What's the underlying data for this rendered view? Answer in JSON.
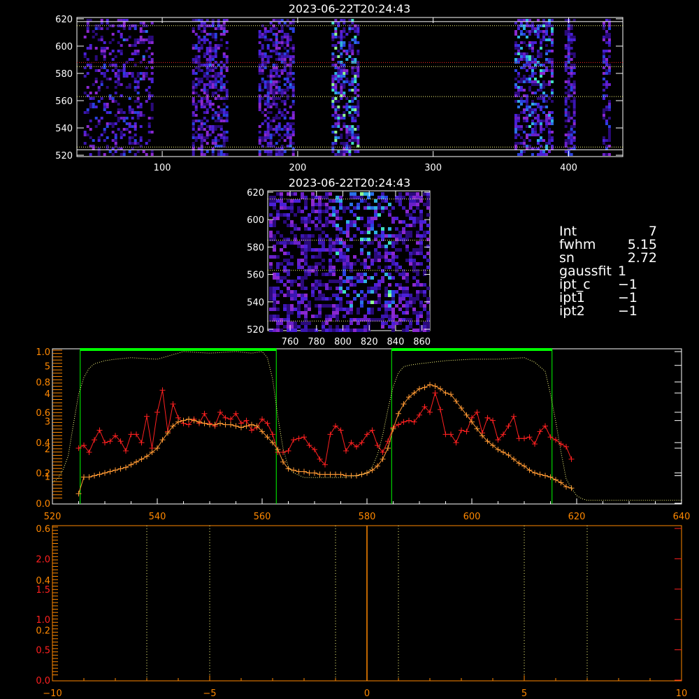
{
  "colors": {
    "white": "#ffffff",
    "red": "#ff2020",
    "orange": "#ff9933",
    "green": "#00ff00",
    "yellow": "#ffff80",
    "axis_orange": "#ff8800",
    "axis_red": "#ff2020"
  },
  "info": [
    {
      "k": "Int",
      "v": "7"
    },
    {
      "k": "fwhm",
      "v": "5.15"
    },
    {
      "k": "sn",
      "v": "2.72"
    },
    {
      "k": "gaussfit",
      "v": "1"
    },
    {
      "k": "ipt_c",
      "v": "−1"
    },
    {
      "k": "ipt1",
      "v": "−1"
    },
    {
      "k": "ipt2",
      "v": "−1"
    }
  ],
  "chart_data": [
    {
      "type": "heatmap",
      "title": "2023-06-22T20:24:43",
      "xlim": [
        37,
        440
      ],
      "ylim": [
        519,
        621
      ],
      "xticks": [
        "100",
        "200",
        "300",
        "400"
      ],
      "xtick_values": [
        100,
        200,
        300,
        400
      ],
      "yticks": [
        "520",
        "540",
        "560",
        "580",
        "600",
        "620"
      ],
      "ytick_values": [
        520,
        540,
        560,
        580,
        600,
        620
      ],
      "hlines": [
        {
          "y": 524,
          "color": "white"
        },
        {
          "y": 618,
          "color": "white"
        },
        {
          "y": 615,
          "color": "yellow",
          "style": "dotted"
        },
        {
          "y": 588,
          "color": "red",
          "style": "dotted"
        },
        {
          "y": 585,
          "color": "yellow",
          "style": "dotted"
        },
        {
          "y": 563,
          "color": "yellow",
          "style": "dotted"
        },
        {
          "y": 526,
          "color": "yellow",
          "style": "dotted"
        }
      ],
      "active_bands": [
        [
          42,
          92
        ],
        [
          122,
          147
        ],
        [
          171,
          197
        ],
        [
          225,
          245
        ],
        [
          360,
          387
        ],
        [
          397,
          405
        ],
        [
          425,
          430
        ]
      ]
    },
    {
      "type": "heatmap",
      "title": "2023-06-22T20:24:43",
      "xlim": [
        743,
        866
      ],
      "ylim": [
        519,
        621
      ],
      "xticks": [
        "760",
        "780",
        "800",
        "820",
        "840",
        "860"
      ],
      "xtick_values": [
        760,
        780,
        800,
        820,
        840,
        860
      ],
      "yticks": [
        "520",
        "540",
        "560",
        "580",
        "600",
        "620"
      ],
      "ytick_values": [
        520,
        540,
        560,
        580,
        600,
        620
      ],
      "hlines": [
        {
          "y": 615,
          "color": "yellow",
          "style": "dotted"
        },
        {
          "y": 585,
          "color": "yellow",
          "style": "dotted"
        },
        {
          "y": 563,
          "color": "yellow",
          "style": "dotted"
        },
        {
          "y": 526,
          "color": "yellow",
          "style": "dotted"
        }
      ]
    },
    {
      "type": "line",
      "xlim": [
        520,
        640
      ],
      "xticks": [
        "520",
        "540",
        "560",
        "580",
        "600",
        "620",
        "640"
      ],
      "xtick_values": [
        520,
        540,
        560,
        580,
        600,
        620,
        640
      ],
      "left_axis_labels": [
        {
          "text": "1.0",
          "value": 1.0
        },
        {
          "text": "0.8",
          "value": 0.8
        },
        {
          "text": "0.6",
          "value": 0.6
        },
        {
          "text": "0.4",
          "value": 0.4
        },
        {
          "text": "0.2",
          "value": 0.2
        },
        {
          "text": "0.0",
          "value": 0.0
        }
      ],
      "second_axis_labels": [
        {
          "text": "5",
          "value": 5
        },
        {
          "text": "4",
          "value": 4
        },
        {
          "text": "3",
          "value": 3
        },
        {
          "text": "2",
          "value": 2
        },
        {
          "text": "1",
          "value": 1
        }
      ],
      "vlines": [
        525.3,
        562.7,
        584.7,
        615.3
      ],
      "bars": [
        [
          525.3,
          562.7
        ],
        [
          584.7,
          615.3
        ]
      ],
      "series": [
        {
          "color": "red",
          "marker": "+",
          "unit": "second_axis",
          "x": [
            525,
            526,
            527,
            528,
            529,
            530,
            531,
            532,
            533,
            534,
            535,
            536,
            537,
            538,
            539,
            540,
            541,
            542,
            543,
            544,
            545,
            546,
            547,
            548,
            549,
            550,
            551,
            552,
            553,
            554,
            555,
            556,
            557,
            558,
            559,
            560,
            561,
            562,
            563,
            564,
            565,
            566,
            567,
            568,
            569,
            570,
            571,
            572,
            573,
            574,
            575,
            576,
            577,
            578,
            579,
            580,
            581,
            582,
            583,
            584,
            585,
            586,
            587,
            588,
            589,
            590,
            591,
            592,
            593,
            594,
            595,
            596,
            597,
            598,
            599,
            600,
            601,
            602,
            603,
            604,
            605,
            606,
            607,
            608,
            609,
            610,
            611,
            612,
            613,
            614,
            615,
            616,
            617,
            618,
            619
          ],
          "y": [
            2.0,
            2.1,
            1.85,
            2.3,
            2.65,
            2.2,
            2.25,
            2.45,
            2.25,
            1.9,
            2.5,
            2.5,
            2.2,
            3.15,
            2.0,
            3.3,
            4.1,
            2.6,
            3.6,
            3.1,
            2.9,
            2.85,
            3.05,
            2.9,
            3.25,
            2.9,
            2.8,
            3.3,
            3.1,
            3.05,
            3.25,
            2.9,
            3.0,
            2.65,
            2.75,
            3.05,
            2.9,
            2.5,
            1.85,
            1.85,
            1.9,
            2.3,
            2.35,
            2.4,
            2.1,
            1.95,
            1.6,
            1.4,
            2.5,
            2.8,
            2.65,
            1.9,
            2.2,
            2.05,
            2.2,
            2.5,
            2.65,
            2.1,
            1.85,
            2.25,
            2.75,
            2.85,
            2.95,
            3.0,
            2.95,
            3.2,
            3.5,
            3.3,
            4.0,
            3.4,
            2.5,
            2.5,
            2.2,
            2.65,
            2.6,
            3.1,
            3.3,
            2.55,
            3.1,
            3.0,
            2.3,
            2.5,
            2.8,
            3.15,
            2.35,
            2.35,
            2.4,
            2.15,
            2.6,
            2.8,
            2.4,
            2.3,
            2.15,
            2.05,
            1.6
          ]
        },
        {
          "color": "orange",
          "marker": "+",
          "unit": "second_axis",
          "x": [
            525,
            526,
            527,
            528,
            529,
            530,
            531,
            532,
            533,
            534,
            535,
            536,
            537,
            538,
            539,
            540,
            541,
            542,
            543,
            544,
            545,
            546,
            547,
            548,
            549,
            550,
            551,
            552,
            553,
            554,
            555,
            556,
            557,
            558,
            559,
            560,
            561,
            562,
            563,
            564,
            565,
            566,
            567,
            568,
            569,
            570,
            571,
            572,
            573,
            574,
            575,
            576,
            577,
            578,
            579,
            580,
            581,
            582,
            583,
            584,
            585,
            586,
            587,
            588,
            589,
            590,
            591,
            592,
            593,
            594,
            595,
            596,
            597,
            598,
            599,
            600,
            601,
            602,
            603,
            604,
            605,
            606,
            607,
            608,
            609,
            610,
            611,
            612,
            613,
            614,
            615,
            616,
            617,
            618,
            619
          ],
          "y": [
            0.35,
            0.95,
            0.95,
            1.0,
            1.05,
            1.1,
            1.15,
            1.2,
            1.25,
            1.3,
            1.4,
            1.5,
            1.6,
            1.7,
            1.85,
            2.0,
            2.3,
            2.55,
            2.8,
            2.95,
            3.0,
            3.05,
            3.0,
            2.95,
            2.9,
            2.85,
            2.85,
            2.9,
            2.85,
            2.85,
            2.8,
            2.75,
            2.8,
            2.85,
            2.8,
            2.6,
            2.4,
            2.2,
            1.95,
            1.5,
            1.25,
            1.2,
            1.15,
            1.15,
            1.1,
            1.1,
            1.05,
            1.05,
            1.05,
            1.05,
            1.05,
            1.0,
            1.0,
            1.0,
            1.05,
            1.1,
            1.2,
            1.35,
            1.6,
            2.0,
            2.7,
            3.25,
            3.6,
            3.85,
            4.0,
            4.15,
            4.2,
            4.3,
            4.25,
            4.15,
            4.0,
            3.95,
            3.7,
            3.45,
            3.2,
            2.95,
            2.7,
            2.45,
            2.25,
            2.1,
            1.95,
            1.85,
            1.75,
            1.6,
            1.45,
            1.35,
            1.2,
            1.1,
            1.05,
            1.0,
            0.95,
            0.85,
            0.75,
            0.6,
            0.55
          ]
        },
        {
          "color": "yellow",
          "style": "dotted",
          "unit": "left_axis",
          "x": [
            520,
            521,
            522,
            523,
            524,
            525,
            526,
            527,
            528,
            529,
            530,
            532,
            535,
            540,
            545,
            550,
            555,
            558,
            560,
            561,
            562,
            563,
            564,
            565,
            566,
            568,
            570,
            575,
            578,
            580,
            581,
            582,
            583,
            584,
            585,
            586,
            587,
            588,
            590,
            595,
            600,
            605,
            610,
            612,
            614,
            615,
            616,
            617,
            618,
            619,
            620,
            621,
            622,
            623,
            625,
            630,
            635,
            640
          ],
          "y": [
            0.14,
            0.16,
            0.22,
            0.31,
            0.52,
            0.72,
            0.83,
            0.89,
            0.92,
            0.93,
            0.94,
            0.95,
            0.96,
            0.95,
            1.0,
            0.99,
            1.0,
            0.99,
            1.0,
            0.96,
            0.82,
            0.57,
            0.36,
            0.24,
            0.2,
            0.17,
            0.17,
            0.17,
            0.18,
            0.2,
            0.24,
            0.32,
            0.45,
            0.62,
            0.77,
            0.86,
            0.9,
            0.91,
            0.92,
            0.94,
            0.95,
            0.95,
            0.96,
            0.93,
            0.87,
            0.72,
            0.54,
            0.34,
            0.16,
            0.1,
            0.05,
            0.03,
            0.02,
            0.02,
            0.02,
            0.02,
            0.02,
            0.02
          ]
        }
      ]
    },
    {
      "type": "line",
      "xlim": [
        -10,
        10
      ],
      "xticks": [
        "−10",
        "−5",
        "0",
        "5",
        "10"
      ],
      "xtick_values": [
        -10,
        -5,
        0,
        5,
        10
      ],
      "left_axis_labels_red": [
        {
          "text": "2.0",
          "value": 0.8
        },
        {
          "text": "1.5",
          "value": 0.6
        },
        {
          "text": "1.0",
          "value": 0.4
        },
        {
          "text": "0.5",
          "value": 0.2
        },
        {
          "text": "0.0",
          "value": 0.0
        }
      ],
      "left_axis_labels_orange": [
        {
          "text": "0.6",
          "value": 1.0
        },
        {
          "text": "0.4",
          "value": 0.66
        },
        {
          "text": "0.2",
          "value": 0.33
        }
      ],
      "vlines_dotted": [
        -7,
        -5,
        -1,
        1,
        5,
        7
      ],
      "vline_solid": 0
    }
  ]
}
